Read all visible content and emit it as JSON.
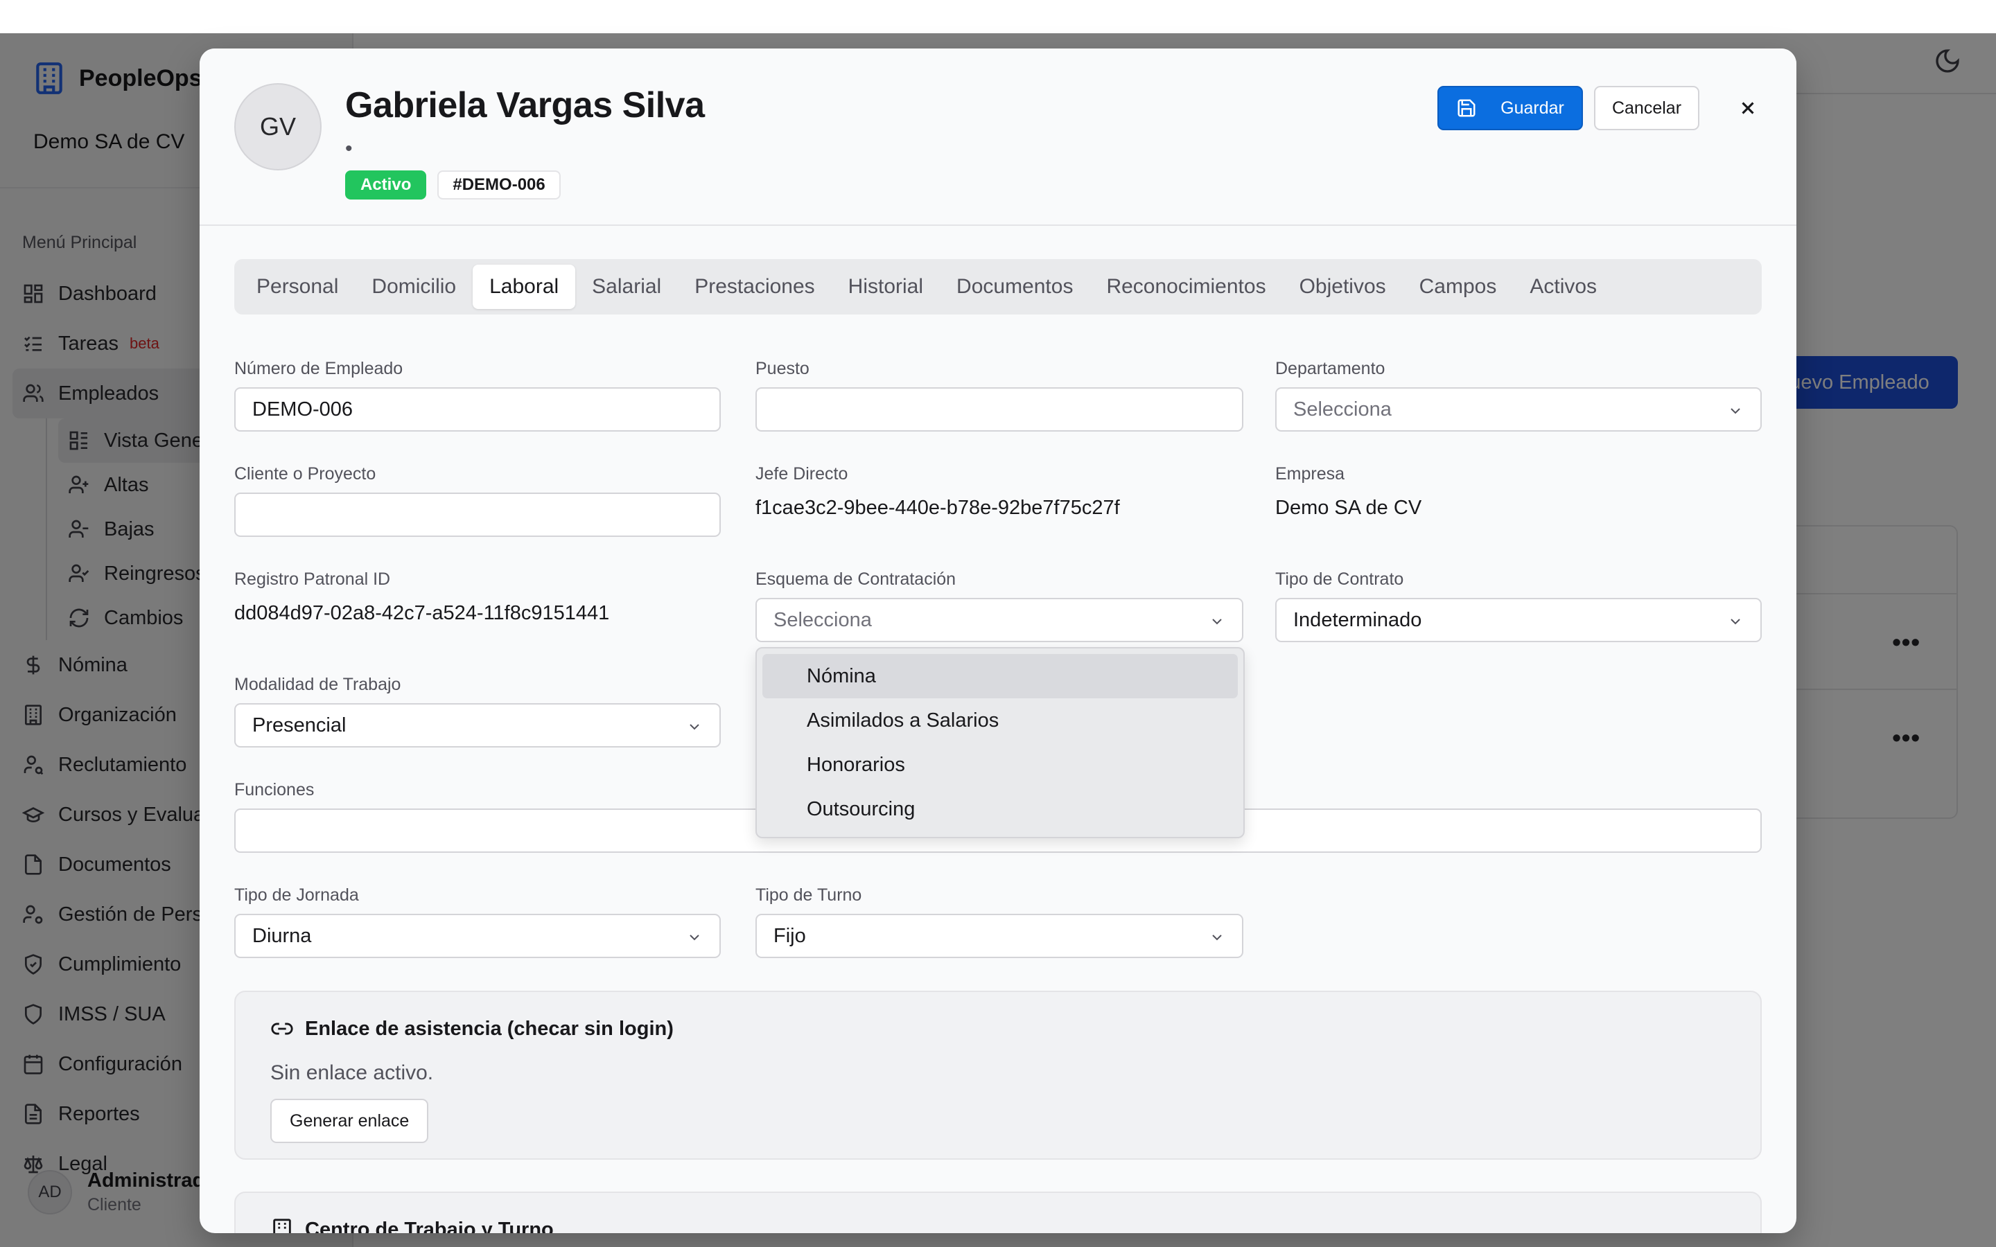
{
  "app": {
    "name": "PeopleOps",
    "company": "Demo SA de CV",
    "menu_section": "Menú Principal"
  },
  "sidebar": {
    "items": [
      {
        "label": "Dashboard",
        "icon": "dashboard-icon"
      },
      {
        "label": "Tareas",
        "icon": "tasks-icon",
        "badge": "beta"
      },
      {
        "label": "Empleados",
        "icon": "users-icon"
      },
      {
        "label": "Nómina",
        "icon": "dollar-icon"
      },
      {
        "label": "Organización",
        "icon": "building-icon"
      },
      {
        "label": "Reclutamiento",
        "icon": "user-search-icon"
      },
      {
        "label": "Cursos y Evaluaciones",
        "icon": "graduation-cap-icon"
      },
      {
        "label": "Documentos",
        "icon": "file-icon"
      },
      {
        "label": "Gestión de Personal",
        "icon": "user-cog-icon"
      },
      {
        "label": "Cumplimiento",
        "icon": "shield-check-icon"
      },
      {
        "label": "IMSS / SUA",
        "icon": "shield-icon"
      },
      {
        "label": "Configuración",
        "icon": "calendar-icon"
      },
      {
        "label": "Reportes",
        "icon": "file-text-icon"
      },
      {
        "label": "Legal",
        "icon": "scale-icon"
      }
    ],
    "sub_items": [
      {
        "label": "Vista General",
        "icon": "list-icon"
      },
      {
        "label": "Altas",
        "icon": "user-plus-icon"
      },
      {
        "label": "Bajas",
        "icon": "user-minus-icon"
      },
      {
        "label": "Reingresos",
        "icon": "user-check-icon"
      },
      {
        "label": "Cambios",
        "icon": "refresh-icon"
      }
    ],
    "user": {
      "initials": "AD",
      "name": "Administrador",
      "role": "Cliente"
    }
  },
  "main": {
    "new_button": "Nuevo Empleado"
  },
  "modal": {
    "avatar_initials": "GV",
    "name": "Gabriela Vargas Silva",
    "subtitle": "•",
    "status_badge": "Activo",
    "id_badge": "#DEMO-006",
    "save_label": "Guardar",
    "cancel_label": "Cancelar",
    "tabs": [
      "Personal",
      "Domicilio",
      "Laboral",
      "Salarial",
      "Prestaciones",
      "Historial",
      "Documentos",
      "Reconocimientos",
      "Objetivos",
      "Campos",
      "Activos"
    ],
    "active_tab": "Laboral",
    "fields": {
      "numero_empleado": {
        "label": "Número de Empleado",
        "value": "DEMO-006"
      },
      "puesto": {
        "label": "Puesto",
        "value": ""
      },
      "departamento": {
        "label": "Departamento",
        "placeholder": "Selecciona"
      },
      "cliente_proyecto": {
        "label": "Cliente o Proyecto",
        "value": ""
      },
      "jefe_directo": {
        "label": "Jefe Directo",
        "value": "f1cae3c2-9bee-440e-b78e-92be7f75c27f"
      },
      "empresa": {
        "label": "Empresa",
        "value": "Demo SA de CV"
      },
      "registro_patronal": {
        "label": "Registro Patronal ID",
        "value": "dd084d97-02a8-42c7-a524-11f8c9151441"
      },
      "esquema": {
        "label": "Esquema de Contratación",
        "placeholder": "Selecciona"
      },
      "tipo_contrato": {
        "label": "Tipo de Contrato",
        "value": "Indeterminado"
      },
      "modalidad": {
        "label": "Modalidad de Trabajo",
        "value": "Presencial"
      },
      "funciones": {
        "label": "Funciones",
        "value": ""
      },
      "tipo_jornada": {
        "label": "Tipo de Jornada",
        "value": "Diurna"
      },
      "tipo_turno": {
        "label": "Tipo de Turno",
        "value": "Fijo"
      }
    },
    "esquema_options": [
      "Nómina",
      "Asimilados a Salarios",
      "Honorarios",
      "Outsourcing"
    ],
    "attendance_card": {
      "title": "Enlace de asistencia (checar sin login)",
      "text": "Sin enlace activo.",
      "button": "Generar enlace"
    },
    "workcenter_card": {
      "title": "Centro de Trabajo y Turno"
    }
  },
  "colors": {
    "primary": "#0b6ee0",
    "success": "#22c55e",
    "overlay": "rgba(0,0,0,0.5)"
  }
}
